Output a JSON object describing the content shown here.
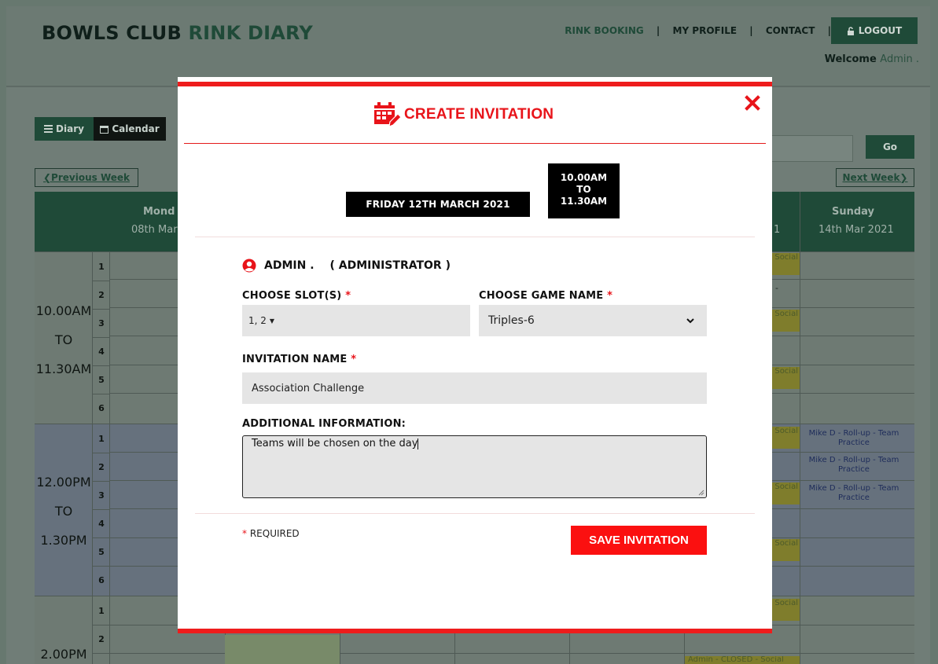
{
  "header": {
    "brand_part1": "BOWLS CLUB",
    "brand_part2": "RINK DIARY",
    "nav": {
      "rink_booking": "RINK BOOKING",
      "sep1": "|",
      "my_profile": "MY PROFILE",
      "sep2": "|",
      "contact": "CONTACT",
      "sep3": "|"
    },
    "logout_label": "LOGOUT",
    "welcome_prefix": "Welcome",
    "welcome_name": "Admin ."
  },
  "toolbar": {
    "diary_label": "Diary",
    "calendar_label": "Calendar",
    "prev_week": "Previous Week",
    "next_week": "Next Week",
    "go_label": "Go"
  },
  "diary": {
    "columns": [
      {
        "day": "Mond",
        "date": "08th Mar"
      },
      {
        "day": "Sunday",
        "date": "14th Mar 2021"
      }
    ],
    "saturday_fragment": "1",
    "blocks": [
      {
        "time_start": "10.00AM",
        "time_to": "TO",
        "time_end": "11.30AM",
        "slots": [
          "1",
          "2",
          "3",
          "4",
          "5",
          "6"
        ]
      },
      {
        "time_start": "12.00PM",
        "time_to": "TO",
        "time_end": "1.30PM",
        "slots": [
          "1",
          "2",
          "3",
          "4",
          "5",
          "6"
        ]
      },
      {
        "time_start": "2.00PM",
        "time_to": "",
        "time_end": "",
        "slots": [
          "1",
          "2"
        ]
      }
    ],
    "social_tag": "Social",
    "dash_mark": "-",
    "sunday_entries": [
      "Mike D - Roll-up - Team Practice",
      "Mike D - Roll-up - Team Practice",
      "Mike D - Roll-up - Team Practice"
    ],
    "closed_bar": "Admin - CLOSED - Social"
  },
  "modal": {
    "title": "CREATE INVITATION",
    "date_chip": "FRIDAY 12TH MARCH 2021",
    "time_chip": {
      "start": "10.00AM",
      "to": "TO",
      "end": "11.30AM"
    },
    "user_name": "ADMIN .",
    "user_role": "( ADMINISTRATOR )",
    "slots_label": "CHOOSE SLOT(S)",
    "slots_value": "1, 2",
    "game_label": "CHOOSE GAME NAME",
    "game_value": "Triples-6",
    "invitation_label": "INVITATION NAME",
    "invitation_value": "Association Challenge",
    "additional_label": "ADDITIONAL INFORMATION:",
    "additional_value": "Teams will be chosen on the day",
    "asterisk": "*",
    "required_note": "REQUIRED",
    "save_label": "SAVE INVITATION"
  },
  "colors": {
    "accent_red": "#ee1c1c",
    "brand_green": "#1f4a38",
    "field_grey": "#e5e5e5"
  },
  "icons": [
    "bars-icon",
    "calendar-icon",
    "lock-icon",
    "calendar-edit-icon",
    "close-icon",
    "user-circle-icon",
    "chevron-down-icon",
    "chevron-left-icon",
    "chevron-right-icon"
  ]
}
